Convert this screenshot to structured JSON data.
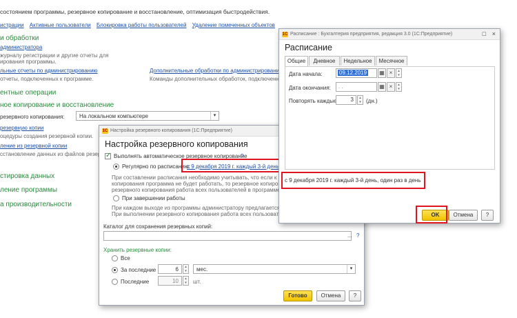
{
  "back": {
    "header_text": "состоянием программы, резервное копирование и восстановление, оптимизация быстродействия.",
    "links_row": [
      "истрации",
      "Активные пользователи",
      "Блокировка работы пользователей",
      "Удаление помеченных объектов"
    ],
    "section_reports": "и обработки",
    "admin_link": "администратора",
    "desc1": "журналу регистрации и другие отчеты для",
    "desc2": "ирования программы.",
    "add_reports_link": "льные отчеты по администрированию",
    "add_reports_desc": "отчеты, подключенных к программе.",
    "add_proc_link": "Дополнительные обработки по администрированию",
    "add_proc_desc": "Команды дополнительных обработок, подключенных к",
    "section_service": "ентные операции",
    "section_backup": "ное копирование и восстановление",
    "backup_label": "резервного копирования:",
    "backup_value": "На локальном компьютере",
    "link_backup": "резервную копии",
    "backup_desc": "оцедуры создания резервной копии.",
    "link_restore": "ление из резервной копии",
    "restore_desc": "сстановление данных из файлов резерв",
    "section_arch": "стировка данных",
    "section_update": "ление программы",
    "section_perf": "а производительности"
  },
  "backup_window": {
    "titlebar": "Настройка резервного копирования  (1С:Предприятие)",
    "title": "Настройка резервного копирования",
    "auto_checkbox": "Выполнять автоматическое резервное копирование",
    "help": "?",
    "radio_schedule": "Регулярно по расписанию:",
    "schedule_link": "с 9 декабря 2019 г. каждый 3-й день",
    "note1": "При составлении расписания необходимо учитывать, что если к моме",
    "note2": "копирования программа не будет работать, то резервное копирова",
    "note3": "резервного копирования работа всех пользователей в программе бу",
    "radio_exit": "При завершении работы",
    "note4": "При каждом выходе из программы администратору предлагается выпо",
    "note5": "При выполнении резервного копирования работа всех пользователей",
    "catalog_label": "Каталог для сохранения резервных копий:",
    "dots": "...",
    "keep_label": "Хранить резервные копии:",
    "opt_all": "Все",
    "opt_last": "За последние",
    "last_value": "6",
    "last_unit": "мес.",
    "opt_recent": "Последние",
    "recent_value": "10",
    "recent_unit": "шт.",
    "btn_done": "Готово",
    "btn_cancel": "Отмена",
    "btn_help": "?"
  },
  "schedule_window": {
    "titlebar": "Расписание : Бухгалтерия предприятия, редакция 3.0  (1С:Предприятие)",
    "title": "Расписание",
    "tabs": [
      "Общие",
      "Дневное",
      "Недельное",
      "Месячное"
    ],
    "start_label": "Дата начала:",
    "start_value": "09.12.2019",
    "end_label": "Дата окончания:",
    "end_value": " .  .",
    "repeat_label": "Повторять каждые:",
    "repeat_value": "3",
    "repeat_unit": "(дн.)",
    "summary": "с 9 декабря 2019 г. каждый 3-й день, один раз в день",
    "btn_ok": "OK",
    "btn_cancel": "Отмена",
    "btn_help": "?"
  }
}
